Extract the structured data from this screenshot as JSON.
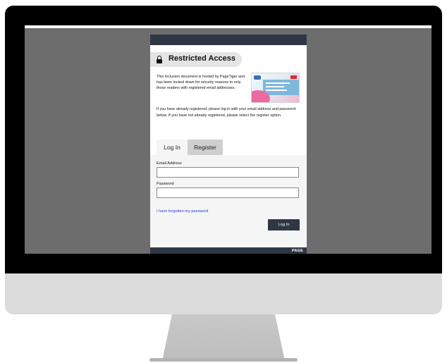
{
  "dialog": {
    "title": "Restricted Access",
    "intro": "This Inclusion document is hosted by PageTiger and has been locked down for security reasons to only those readers with registered email addresses.",
    "instructions": "If you have already registered, please log in with your email address and password below. If you have not already registered, please select the register option."
  },
  "tabs": {
    "login_label": "Log In",
    "register_label": "Register"
  },
  "form": {
    "email_label": "Email Address",
    "email_value": "",
    "password_label": "Password",
    "password_value": "",
    "forgot_link": "I have forgotten my password",
    "login_button": "Log In"
  },
  "footer": {
    "brand": "PAGE"
  },
  "icons": {
    "title_icon": "lock-icon"
  },
  "colors": {
    "dark_bar": "#2f3744",
    "link": "#1f3ecf",
    "screen_backdrop": "#6d6d6d",
    "monitor_bezel": "#000000",
    "monitor_chin": "#dcdcdc"
  }
}
